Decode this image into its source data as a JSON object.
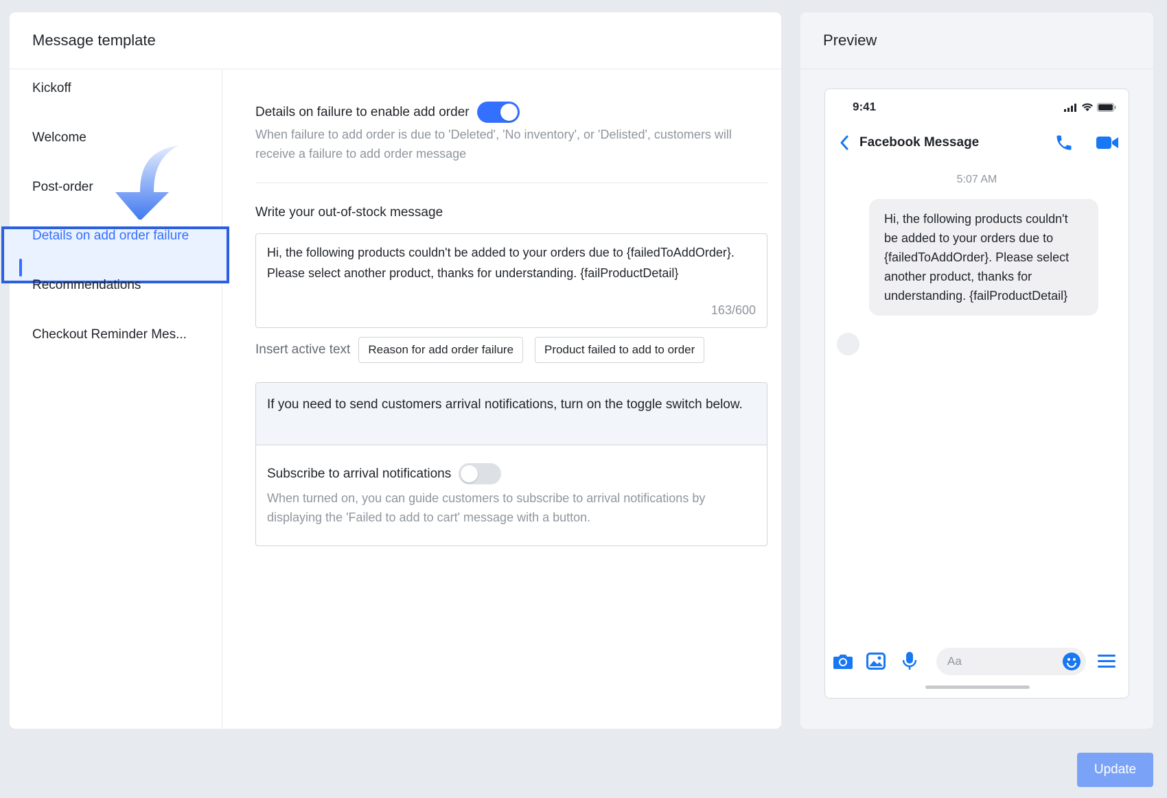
{
  "template": {
    "title": "Message template",
    "nav": [
      {
        "label": "Kickoff"
      },
      {
        "label": "Welcome"
      },
      {
        "label": "Post-order"
      },
      {
        "label": "Details on add order failure"
      },
      {
        "label": "Recommendations"
      },
      {
        "label": "Checkout Reminder Mes..."
      }
    ],
    "active_nav_index": 3
  },
  "failure": {
    "toggle_label": "Details on failure to enable add order",
    "toggle_on": true,
    "description": "When failure to add order is due to 'Deleted', 'No inventory', or 'Delisted', customers will receive a failure to add order message"
  },
  "message": {
    "label": "Write your out-of-stock message",
    "text": "Hi, the following products couldn't be added to your orders due to {failedToAddOrder}. Please select another product, thanks for understanding. {failProductDetail}",
    "counter": "163/600"
  },
  "insert": {
    "label": "Insert active text",
    "chips": [
      "Reason for add order failure",
      "Product failed to add to order"
    ]
  },
  "arrival": {
    "notice": "If you need to send customers arrival notifications, turn on the toggle switch below.",
    "toggle_label": "Subscribe to arrival notifications",
    "toggle_on": false,
    "description": "When turned on, you can guide customers to subscribe to arrival notifications by displaying the 'Failed to add to cart' message with a button."
  },
  "preview": {
    "title": "Preview",
    "status_time": "9:41",
    "chat_title": "Facebook Message",
    "timestamp": "5:07 AM",
    "bubble_text": "Hi, the following products couldn't be added to your orders due to {failedToAddOrder}. Please select another product, thanks for understanding. {failProductDetail}",
    "input_placeholder": "Aa",
    "icons": [
      "back-chevron-icon",
      "phone-icon",
      "video-icon",
      "camera-icon",
      "image-icon",
      "microphone-icon",
      "emoji-icon",
      "menu-icon"
    ]
  },
  "actions": {
    "update_label": "Update"
  },
  "colors": {
    "accent": "#3370ff",
    "update_button": "#7aa3f7"
  }
}
